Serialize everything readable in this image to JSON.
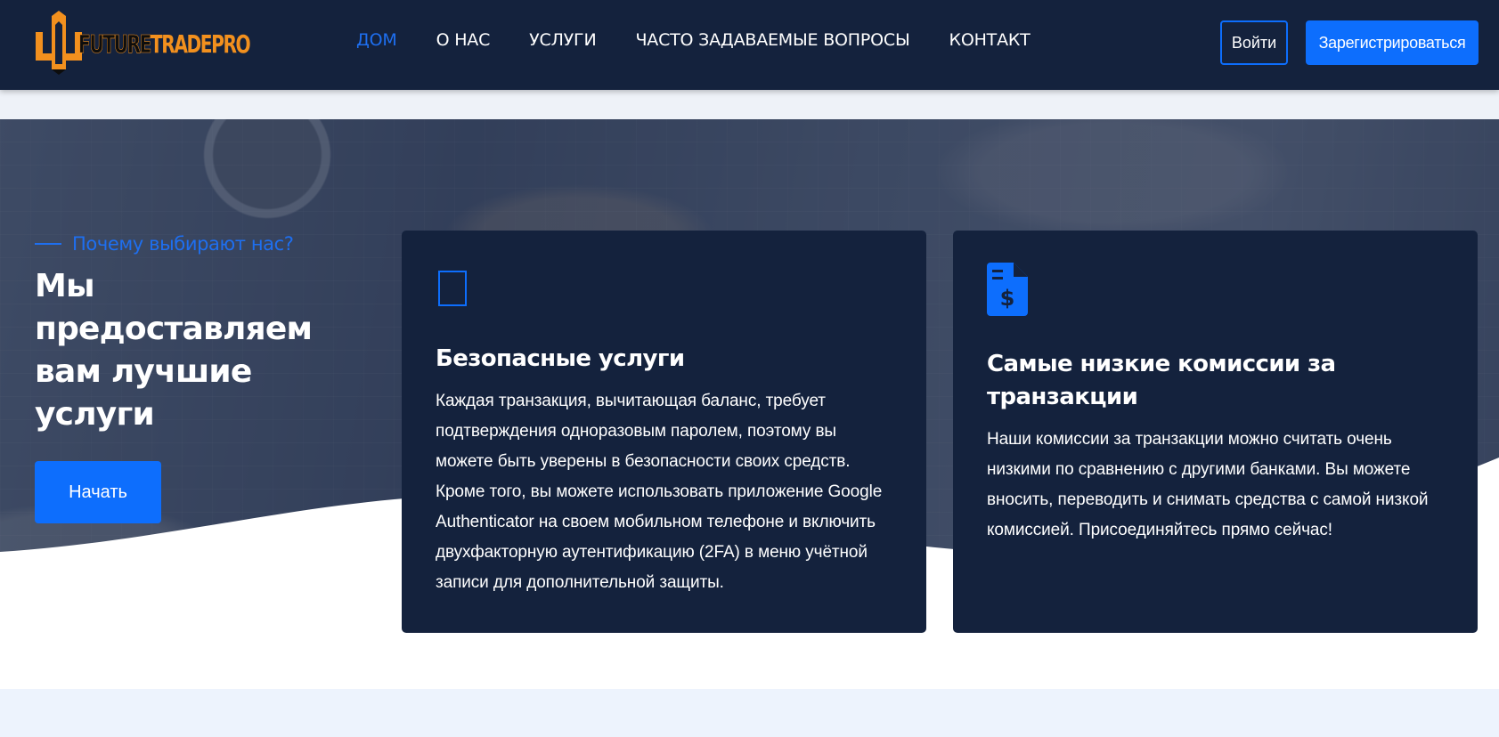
{
  "colors": {
    "navbar_bg": "#14223d",
    "accent": "#0d6efd",
    "logo_orange": "#f2901e",
    "card_bg": "#14223d",
    "light_band": "#edf3fd"
  },
  "header": {
    "logo": {
      "part1": "FUTURE",
      "part2": "TRADEPRO",
      "icon": "logo-building-icon"
    },
    "nav": [
      {
        "label": "ДОМ",
        "active": true
      },
      {
        "label": "О НАС",
        "active": false
      },
      {
        "label": "УСЛУГИ",
        "active": false
      },
      {
        "label": "ЧАСТО ЗАДАВАЕМЫЕ ВОПРОСЫ",
        "active": false
      },
      {
        "label": "КОНТАКТ",
        "active": false
      }
    ],
    "login_label": "Войти",
    "register_label": "Зарегистрироваться"
  },
  "hero": {
    "eyebrow": "Почему выбирают нас?",
    "title": "Мы предоставляем вам лучшие услуги",
    "cta_label": "Начать"
  },
  "cards": [
    {
      "icon": "shield-outline-icon",
      "title": "Безопасные услуги",
      "text": "Каждая транзакция, вычитающая баланс, требует подтверждения одноразовым паролем, поэтому вы можете быть уверены в безопасности своих средств. Кроме того, вы можете использовать приложение Google Authenticator на своем мобильном телефоне и включить двухфакторную аутентификацию (2FA) в меню учётной записи для дополнительной защиты."
    },
    {
      "icon": "invoice-dollar-icon",
      "title": "Самые низкие комиссии за транзакции",
      "text": "Наши комиссии за транзакции можно считать очень низкими по сравнению с другими банками. Вы можете вносить, переводить и снимать средства с самой низкой комиссией. Присоединяйтесь прямо сейчас!"
    }
  ]
}
